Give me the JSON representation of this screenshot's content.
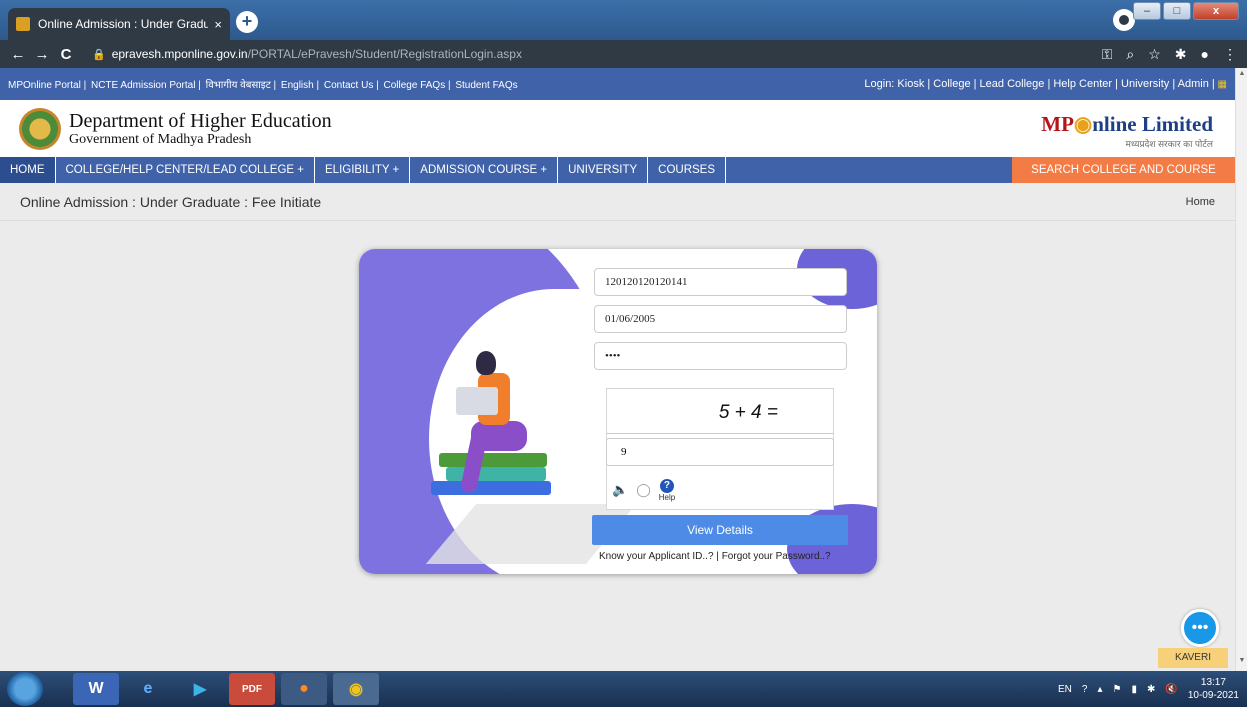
{
  "browser": {
    "tab_title": "Online Admission : Under Gradu",
    "tab_close": "×",
    "new_tab": "+",
    "url_host": "epravesh.mponline.gov.in",
    "url_path": "/PORTAL/ePravesh/Student/RegistrationLogin.aspx",
    "back_icon": "←",
    "forward_icon": "→",
    "reload_icon": "C"
  },
  "top_links": {
    "left": [
      "MPOnline Portal |",
      "NCTE Admission Portal |",
      "विभागीय वेबसाइट |",
      "English |",
      "Contact Us |",
      "College FAQs |",
      "Student FAQs"
    ],
    "right": "Login: Kiosk | College | Lead College | Help Center | University | Admin |"
  },
  "header": {
    "title": "Department of Higher Education",
    "subtitle": "Government of Madhya Pradesh",
    "logo_mp": "MP",
    "logo_online": "nline Limited",
    "logo_tag": "मध्यप्रदेश सरकार का पोर्टल"
  },
  "menu": {
    "items": [
      "HOME",
      "COLLEGE/HELP CENTER/LEAD COLLEGE +",
      "ELIGIBILITY +",
      "ADMISSION COURSE +",
      "UNIVERSITY",
      "COURSES"
    ],
    "search": "SEARCH COLLEGE AND COURSE"
  },
  "breadcrumb": {
    "title": "Online Admission : Under Graduate : Fee Initiate",
    "home": "Home"
  },
  "form": {
    "applicant_id": "120120120120141",
    "dob": "01/06/2005",
    "password": "••••",
    "captcha_expression": "5 + 4 =",
    "captcha_answer": "9",
    "help_label": "Help",
    "submit_label": "View Details",
    "link_applicant": "Know your Applicant ID..?",
    "link_separator": "|",
    "link_password": "Forgot your Password..?"
  },
  "chat": {
    "label": "KAVERI"
  },
  "taskbar": {
    "lang": "EN",
    "time": "13:17",
    "date": "10-09-2021"
  },
  "colors": {
    "nav_blue": "#3f62a9",
    "search_orange": "#f27b46",
    "button_blue": "#4d8be6",
    "accent_purple": "#7e72e0"
  }
}
